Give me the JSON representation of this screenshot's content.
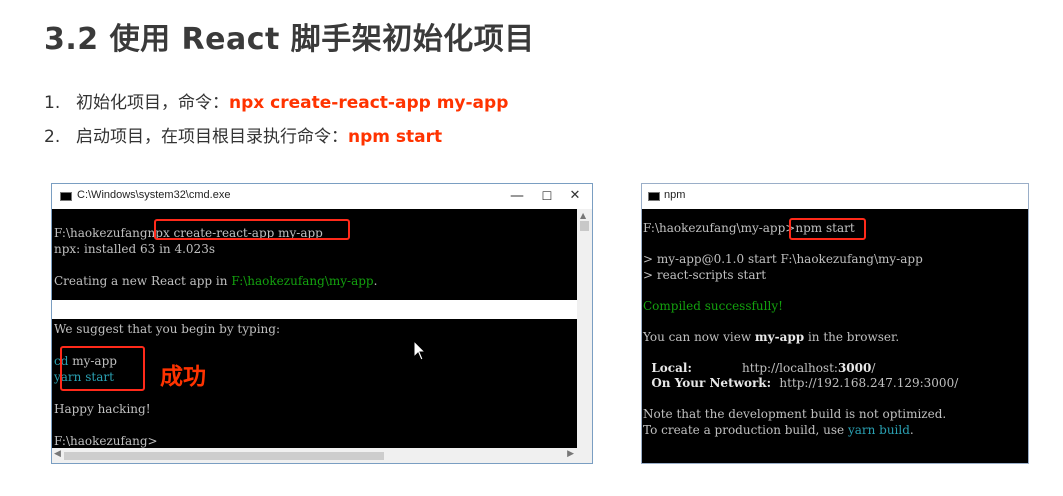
{
  "title": "3.2 使用 React 脚手架初始化项目",
  "steps": [
    {
      "num": "1.",
      "text": "初始化项目，命令：",
      "cmd": "npx create-react-app  my-app"
    },
    {
      "num": "2.",
      "text": "启动项目，在项目根目录执行命令：",
      "cmd": "npm start"
    }
  ],
  "cmd_window": {
    "title": "C:\\Windows\\system32\\cmd.exe",
    "controls": {
      "minimize": "—",
      "maximize": "☐",
      "close": "✕"
    },
    "block1": {
      "prompt": "F:\\haokezufang",
      "command": "npx create-react-app my-app",
      "installed": "npx: installed 63 in 4.023s",
      "creating_prefix": "Creating a new React app in ",
      "creating_path": "F:\\haokezufang\\my-app",
      "creating_suffix": "."
    },
    "block2": {
      "suggest": "We suggest that you begin by typing:",
      "cd_keyword": "cd",
      "cd_arg": " my-app",
      "yarn_start": "yarn start",
      "happy": "Happy hacking!",
      "final_prompt": "F:\\haokezufang>"
    }
  },
  "success_label": "成功",
  "npm_window": {
    "title": "npm",
    "prompt": "F:\\haokezufang\\my-app>",
    "command": "npm start",
    "run_line1": "> my-app@0.1.0 start F:\\haokezufang\\my-app",
    "run_line2": "> react-scripts start",
    "compiled": "Compiled successfully!",
    "view_prefix": "You can now view ",
    "view_app": "my-app",
    "view_suffix": " in the browser.",
    "local_label": "  Local:            ",
    "local_url_prefix": "http://localhost:",
    "local_port": "3000",
    "local_url_suffix": "/",
    "network_label": "  On Your Network:  ",
    "network_url": "http://192.168.247.129:3000/",
    "note1": "Note that the development build is not optimized.",
    "note2_prefix": "To create a production build, use ",
    "note2_cmd": "yarn build",
    "note2_suffix": "."
  }
}
